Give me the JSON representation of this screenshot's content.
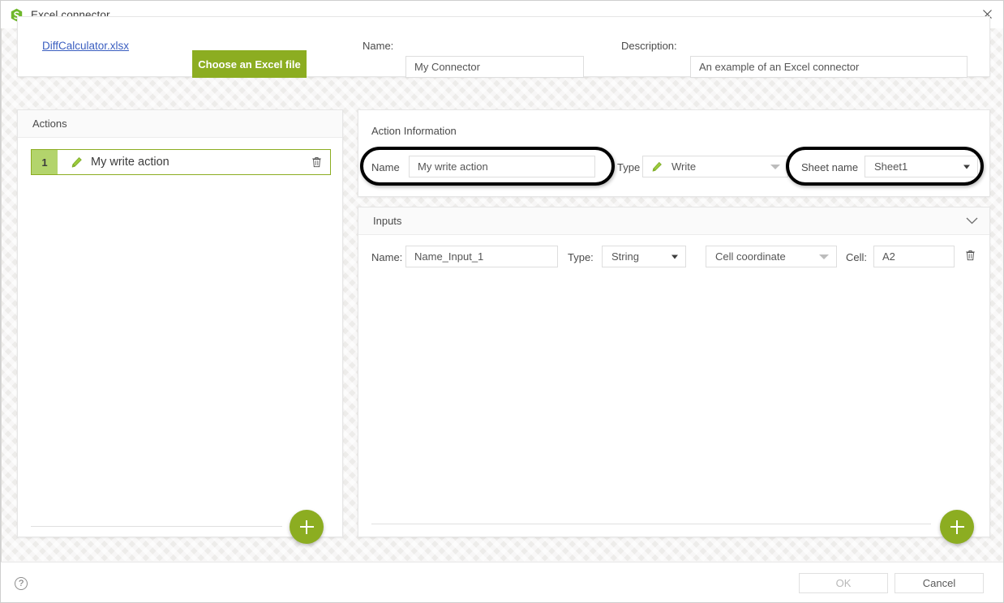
{
  "window": {
    "title": "Excel connector",
    "app_icon": "excel-connector-icon",
    "close_icon": "close-icon",
    "accent_green": "#8cad21",
    "badge_green": "#b3d46c",
    "link_blue": "#3a5ec0"
  },
  "top": {
    "file_link": "DiffCalculator.xlsx",
    "choose_button": "Choose an Excel file",
    "name_label": "Name:",
    "name_value": "My Connector",
    "description_label": "Description:",
    "description_value": "An example of an Excel connector"
  },
  "actions_panel": {
    "header": "Actions",
    "add_button_icon": "plus-icon",
    "rows": [
      {
        "number": "1",
        "icon": "pencil-icon",
        "label": "My write action",
        "delete_icon": "trash-icon"
      }
    ]
  },
  "action_information": {
    "header": "Action Information",
    "name_label": "Name",
    "name_value": "My write action",
    "type_label": "Type",
    "type_value": "Write",
    "type_icon": "pencil-icon",
    "sheet_label": "Sheet name",
    "sheet_value": "Sheet1"
  },
  "inputs_panel": {
    "header": "Inputs",
    "collapse_icon": "chevron-down-icon",
    "add_button_icon": "plus-icon",
    "rows": [
      {
        "name_label": "Name:",
        "name_value": "Name_Input_1",
        "type_label": "Type:",
        "type_value": "String",
        "source_value": "Cell coordinate",
        "cell_label": "Cell:",
        "cell_value": "A2",
        "delete_icon": "trash-icon"
      }
    ]
  },
  "footer": {
    "help_icon": "help-icon",
    "help_glyph": "?",
    "ok_label": "OK",
    "cancel_label": "Cancel"
  },
  "annotations": {
    "ellipse_name": "highlight-ellipse-name-field",
    "ellipse_sheet": "highlight-ellipse-sheet-name"
  }
}
